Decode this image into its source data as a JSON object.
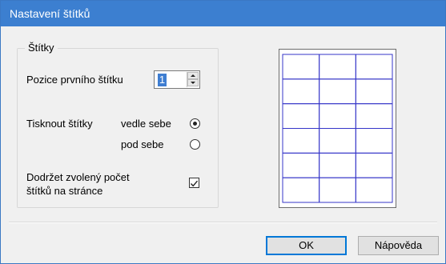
{
  "window": {
    "title": "Nastavení štítků"
  },
  "group": {
    "legend": "Štítky"
  },
  "first_label": {
    "label": "Pozice prvního štítku",
    "value": "1"
  },
  "print_mode": {
    "label": "Tisknout štítky",
    "options": [
      {
        "label": "vedle sebe",
        "selected": true
      },
      {
        "label": "pod sebe",
        "selected": false
      }
    ]
  },
  "keep_count": {
    "label_line1": "Dodržet zvolený počet",
    "label_line2": "štítků na stránce",
    "checked": true
  },
  "preview": {
    "rows": 6,
    "cols": 3,
    "grid_color": "#3535c8"
  },
  "buttons": {
    "ok": "OK",
    "help": "Nápověda"
  }
}
